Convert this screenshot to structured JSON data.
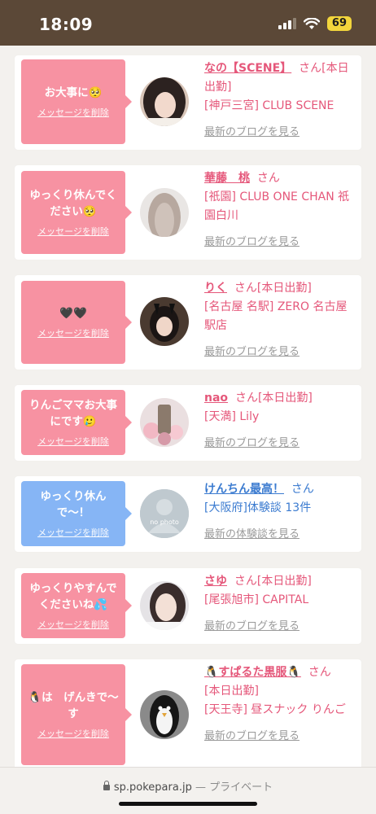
{
  "status": {
    "time": "18:09",
    "battery": "69"
  },
  "messages": [
    {
      "message": "お大事に🥺",
      "delete_label": "メッセージを削除",
      "name": "なの【SCENE】",
      "honorific": "さん",
      "status": "[本日出勤]",
      "shop": "[神戸三宮] CLUB SCENE",
      "link": "最新のブログを見る"
    },
    {
      "message": "ゆっくり休んでください🥺",
      "delete_label": "メッセージを削除",
      "name": "華藤　桃",
      "honorific": "さん",
      "status": "",
      "shop": "[祇園] CLUB ONE CHAN 祇園白川",
      "link": "最新のブログを見る"
    },
    {
      "message": "🖤🖤",
      "delete_label": "メッセージを削除",
      "name": "りく",
      "honorific": "さん",
      "status": "[本日出勤]",
      "shop": "[名古屋 名駅] ZERO 名古屋駅店",
      "link": "最新のブログを見る"
    },
    {
      "message": "りんごママお大事にです🥲",
      "delete_label": "メッセージを削除",
      "name": "nao",
      "honorific": "さん",
      "status": "[本日出勤]",
      "shop": "[天満] Lily",
      "link": "最新のブログを見る"
    },
    {
      "message": "ゆっくり休んで〜！",
      "delete_label": "メッセージを削除",
      "name": "けんちん最高！",
      "honorific": "さん",
      "status": "",
      "shop": "[大阪府]体験談 13件",
      "link": "最新の体験談を見る",
      "avatar_text": "no photo"
    },
    {
      "message": "ゆっくりやすんでくださいね💦",
      "delete_label": "メッセージを削除",
      "name": "さゆ",
      "honorific": "さん",
      "status": "[本日出勤]",
      "shop": "[尾張旭市] CAPITAL",
      "link": "最新のブログを見る"
    },
    {
      "message": "🐧は　げんきで〜す",
      "delete_label": "メッセージを削除",
      "name": "🐧すぱるた黒服🐧",
      "honorific": "さん",
      "status": "[本日出勤]",
      "shop": "[天王寺] 昼スナック りんご",
      "link": "最新のブログを見る"
    }
  ],
  "browser": {
    "domain": "sp.pokepara.jp",
    "separator": "—",
    "mode": "プライベート"
  },
  "colors": {
    "header": "#5b4837",
    "pink_bubble": "#f792a2",
    "blue_bubble": "#86b5f5",
    "name_pink": "#e5577a",
    "name_blue": "#3b7bd0"
  }
}
